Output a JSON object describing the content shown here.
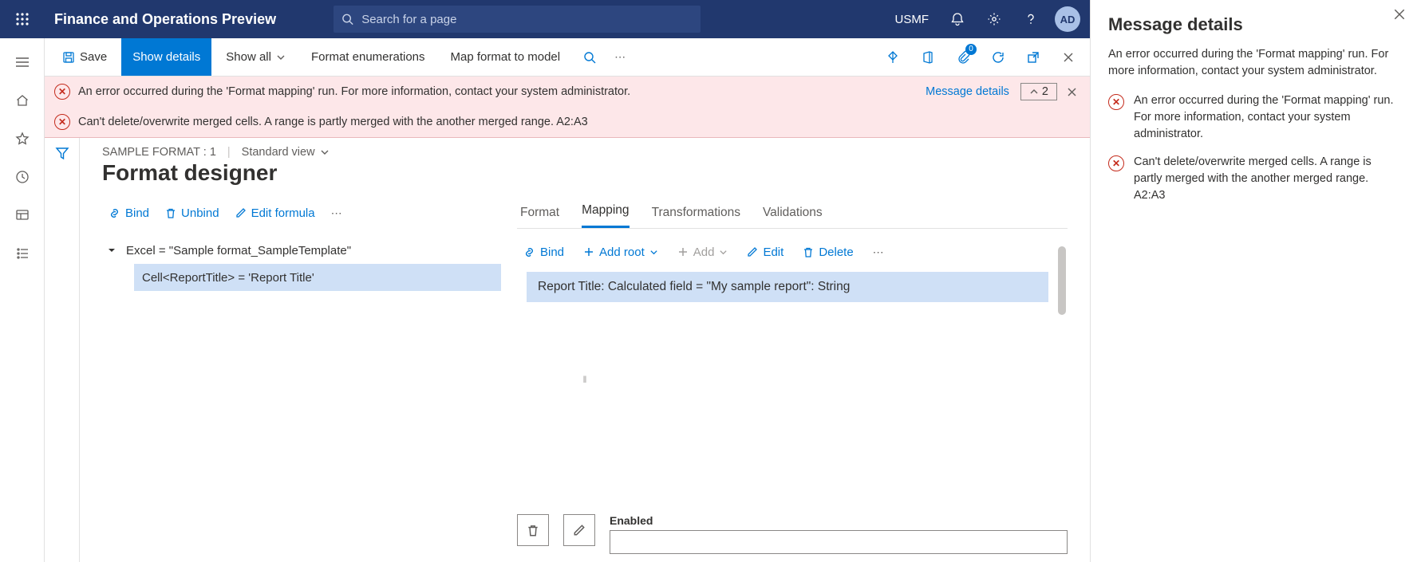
{
  "topbar": {
    "title": "Finance and Operations Preview",
    "search_placeholder": "Search for a page",
    "company": "USMF",
    "avatar_initials": "AD"
  },
  "cmdbar": {
    "save": "Save",
    "show_details": "Show details",
    "show_all": "Show all",
    "format_enum": "Format enumerations",
    "map_format": "Map format to model",
    "attach_badge": "0"
  },
  "banners": {
    "b1": "An error occurred during the 'Format mapping' run. For more information, contact your system administrator.",
    "b2": "Can't delete/overwrite merged cells. A range is partly merged with the another merged range. A2:A3",
    "details_link": "Message details",
    "count": "2"
  },
  "designer": {
    "breadcrumb": "SAMPLE FORMAT : 1",
    "view": "Standard view",
    "title": "Format designer",
    "left_toolbar": {
      "bind": "Bind",
      "unbind": "Unbind",
      "edit_formula": "Edit formula"
    },
    "tree": {
      "root": "Excel = \"Sample format_SampleTemplate\"",
      "child": "Cell<ReportTitle> = 'Report Title'"
    },
    "tabs": {
      "format": "Format",
      "mapping": "Mapping",
      "transformations": "Transformations",
      "validations": "Validations"
    },
    "right_toolbar": {
      "bind": "Bind",
      "add_root": "Add root",
      "add": "Add",
      "edit": "Edit",
      "delete": "Delete"
    },
    "mapping_row": "Report Title: Calculated field = \"My sample report\": String",
    "enabled_label": "Enabled"
  },
  "side_panel": {
    "title": "Message details",
    "summary": "An error occurred during the 'Format mapping' run. For more information, contact your system administrator.",
    "msg1": "An error occurred during the 'Format mapping' run. For more information, contact your system administrator.",
    "msg2": "Can't delete/overwrite merged cells. A range is partly merged with the another merged range. A2:A3"
  }
}
